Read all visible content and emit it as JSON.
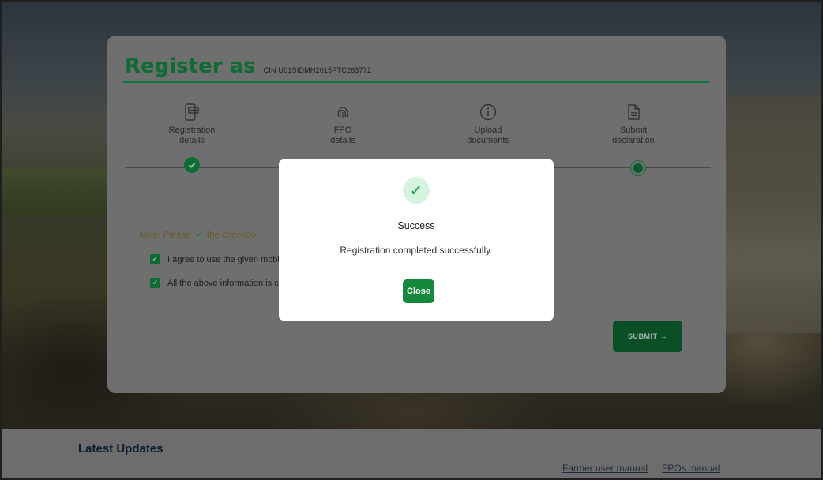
{
  "card": {
    "title": "Register as",
    "cin": "CIN U01SIDMH2015PTC263772"
  },
  "steps": [
    {
      "icon": "phone-form-icon",
      "line1": "Registration",
      "line2": "details",
      "state": "completed"
    },
    {
      "icon": "fingerprint-icon",
      "line1": "FPO",
      "line2": "details",
      "state": "completed"
    },
    {
      "icon": "info-icon",
      "line1": "Upload",
      "line2": "documents",
      "state": "completed"
    },
    {
      "icon": "document-icon",
      "line1": "Submit",
      "line2": "declaration",
      "state": "current"
    }
  ],
  "note": {
    "prefix": "Note: Please",
    "suffix": "the checkbo"
  },
  "checkboxes": [
    {
      "label": "I agree to use the given mobi",
      "checked": true
    },
    {
      "label": "All the above information is c",
      "checked": true
    }
  ],
  "submit_label": "SUBMIT →",
  "modal": {
    "title": "Success",
    "message": "Registration completed successfully.",
    "close_label": "Close"
  },
  "footer": {
    "latest_updates": "Latest Updates",
    "links": [
      "Farmer user manual",
      "FPOs manual"
    ]
  },
  "colors": {
    "brand_green": "#0f7a3c",
    "close_button": "#14893d",
    "success_icon_bg": "#d6f3df"
  }
}
